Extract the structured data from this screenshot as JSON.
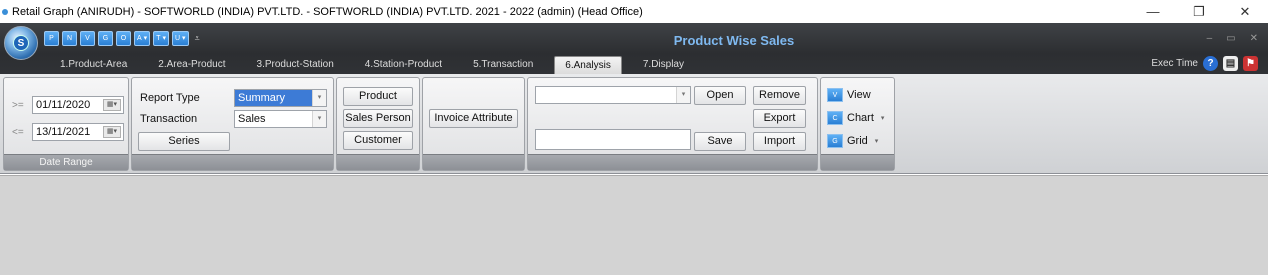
{
  "window": {
    "title": "Retail Graph (ANIRUDH) - SOFTWORLD (INDIA) PVT.LTD. - SOFTWORLD (INDIA) PVT.LTD.  2021 - 2022 (admin) (Head Office)",
    "minimize": "—",
    "maximize": "❐",
    "close": "✕"
  },
  "app": {
    "orb_letter": "S",
    "title": "Product Wise Sales",
    "mdi_min": "–",
    "mdi_max": "▭",
    "mdi_close": "✕"
  },
  "quick_access": [
    {
      "icon": "P",
      "label": "P"
    },
    {
      "icon": "N",
      "label": "N"
    },
    {
      "icon": "V",
      "label": "V"
    },
    {
      "icon": "G",
      "label": "G"
    },
    {
      "icon": "O",
      "label": "O"
    },
    {
      "icon": "A",
      "label": "A"
    },
    {
      "icon": "T",
      "label": "T"
    },
    {
      "icon": "U",
      "label": "U"
    }
  ],
  "tabs": [
    {
      "label": "1.Product-Area"
    },
    {
      "label": "2.Area-Product"
    },
    {
      "label": "3.Product-Station"
    },
    {
      "label": "4.Station-Product"
    },
    {
      "label": "5.Transaction"
    },
    {
      "label": "6.Analysis",
      "active": true
    },
    {
      "label": "7.Display"
    }
  ],
  "exec": {
    "label": "Exec Time"
  },
  "date_range": {
    "group_label": "Date Range",
    "from_op": ">=",
    "from_value": "01/11/2020",
    "to_op": "<=",
    "to_value": "13/11/2021"
  },
  "report": {
    "report_type_label": "Report Type",
    "report_type_value": "Summary",
    "transaction_label": "Transaction",
    "transaction_value": "Sales",
    "series_button": "Series"
  },
  "dimensions": {
    "product": "Product",
    "sales_person": "Sales Person",
    "customer": "Customer"
  },
  "attributes": {
    "invoice_attribute": "Invoice Attribute"
  },
  "layout_tools": {
    "preset_value": "",
    "name_value": "",
    "open": "Open",
    "remove": "Remove",
    "export": "Export",
    "save": "Save",
    "import": "Import"
  },
  "view_options": {
    "view": "View",
    "chart": "Chart",
    "grid": "Grid"
  },
  "colors": {
    "title_blue": "#7fb9f0",
    "ribbon_dark": "#2c2e31",
    "selection": "#3d7bd6",
    "content_bg": "#d3d3d3"
  }
}
